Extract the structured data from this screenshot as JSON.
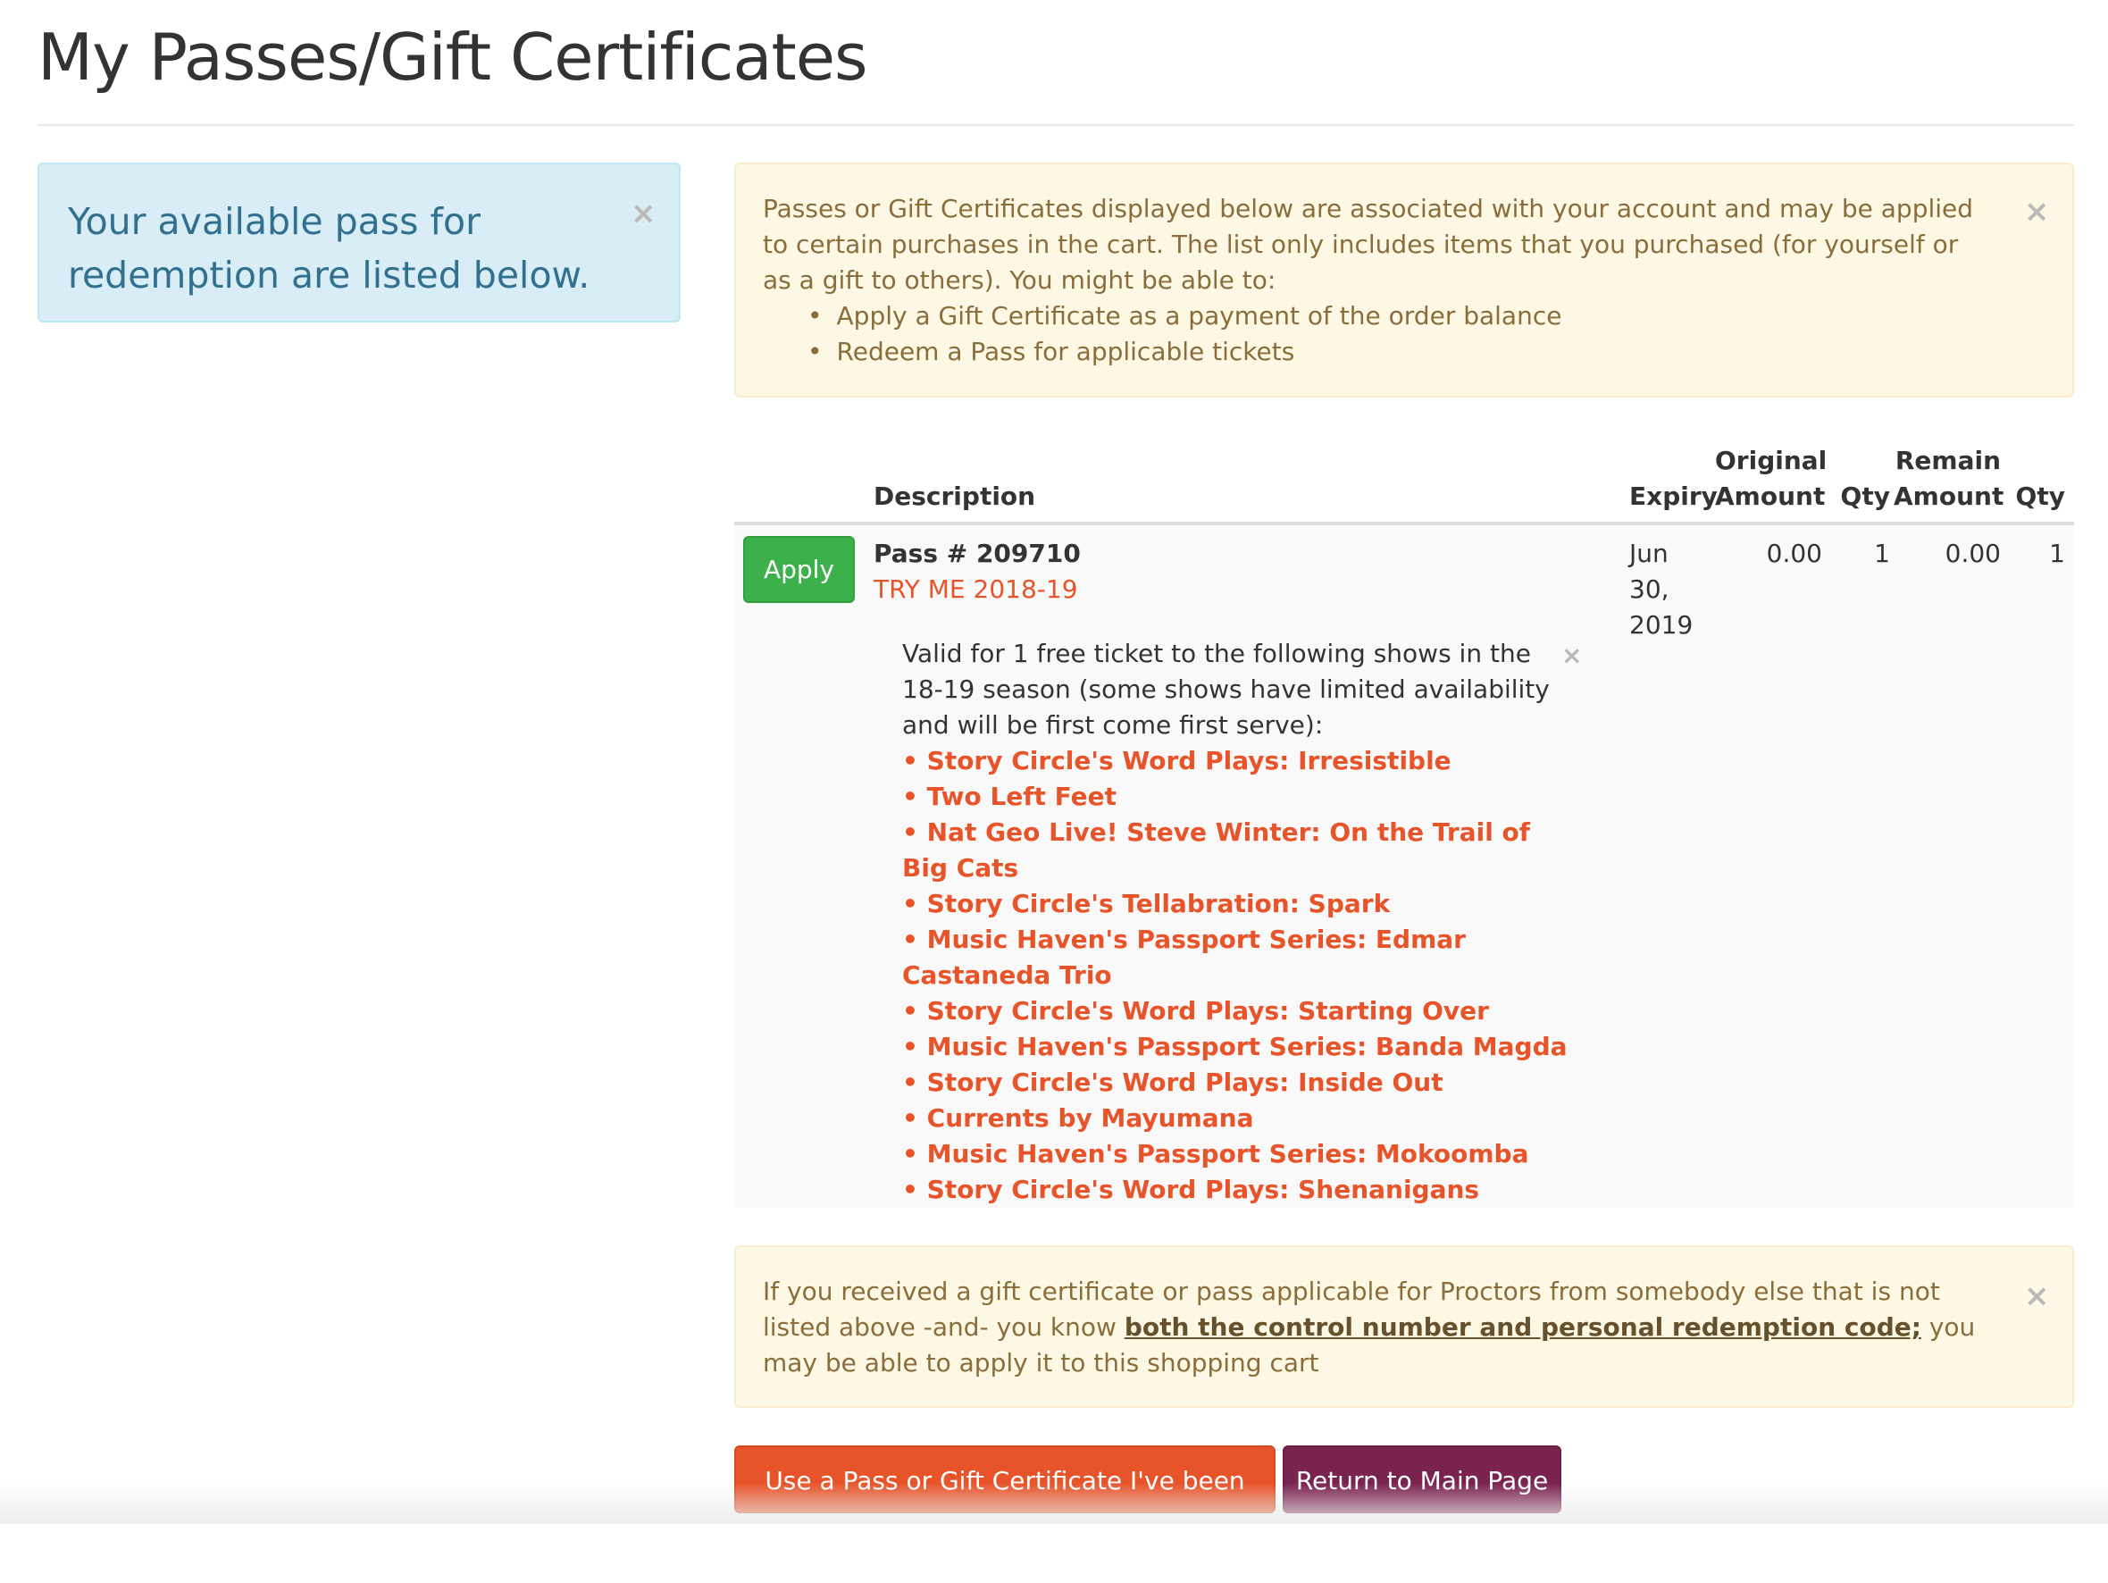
{
  "page": {
    "title": "My Passes/Gift Certificates"
  },
  "info_alert": {
    "message": "Your available pass for redemption are listed below.",
    "close": "×"
  },
  "top_notice": {
    "text": "Passes or Gift Certificates displayed below are associated with your account and may be applied to certain purchases in the cart. The list only includes items that you purchased (for yourself or as a gift to others). You might be able to:",
    "items": [
      "Apply a Gift Certificate as a payment of the order balance",
      "Redeem a Pass for applicable tickets"
    ],
    "close": "×"
  },
  "table": {
    "headers": {
      "description": "Description",
      "expiry": "Expiry",
      "original_top": "Original",
      "original_bottom": "Amount",
      "qty1": "Qty",
      "remain_top": "Remain",
      "remain_bottom": "Amount",
      "qty2": "Qty"
    },
    "rows": [
      {
        "apply_label": "Apply",
        "pass_number": "Pass # 209710",
        "pass_name": "TRY ME 2018-19",
        "expiry_month": "Jun",
        "expiry_day": "30,",
        "expiry_year": "2019",
        "original_amount": "0.00",
        "original_qty": "1",
        "remain_amount": "0.00",
        "remain_qty": "1",
        "details": {
          "intro": "Valid for 1 free ticket to the following shows in the 18-19 season (some shows have limited availability and will be first come first serve):",
          "close": "×",
          "shows": [
            "• Story Circle's Word Plays: Irresistible",
            "• Two Left Feet",
            "• Nat Geo Live! Steve Winter: On the Trail of Big Cats",
            "• Story Circle's Tellabration: Spark",
            "• Music Haven's Passport Series: Edmar Castaneda Trio",
            "• Story Circle's Word Plays: Starting Over",
            "• Music Haven's Passport Series: Banda Magda",
            "• Story Circle's Word Plays: Inside Out",
            "• Currents by Mayumana",
            "• Music Haven's Passport Series: Mokoomba",
            "• Story Circle's Word Plays: Shenanigans"
          ]
        }
      }
    ]
  },
  "bottom_notice": {
    "text_before": "If you received a gift certificate or pass applicable for Proctors from somebody else that is not listed above -and- you know ",
    "link": "both the control number and personal redemption code;",
    "text_after": " you may be able to apply it to this shopping cart",
    "close": "×"
  },
  "buttons": {
    "use_pass": "Use a Pass or Gift Certificate I've been given",
    "return_main": "Return to Main Page"
  }
}
